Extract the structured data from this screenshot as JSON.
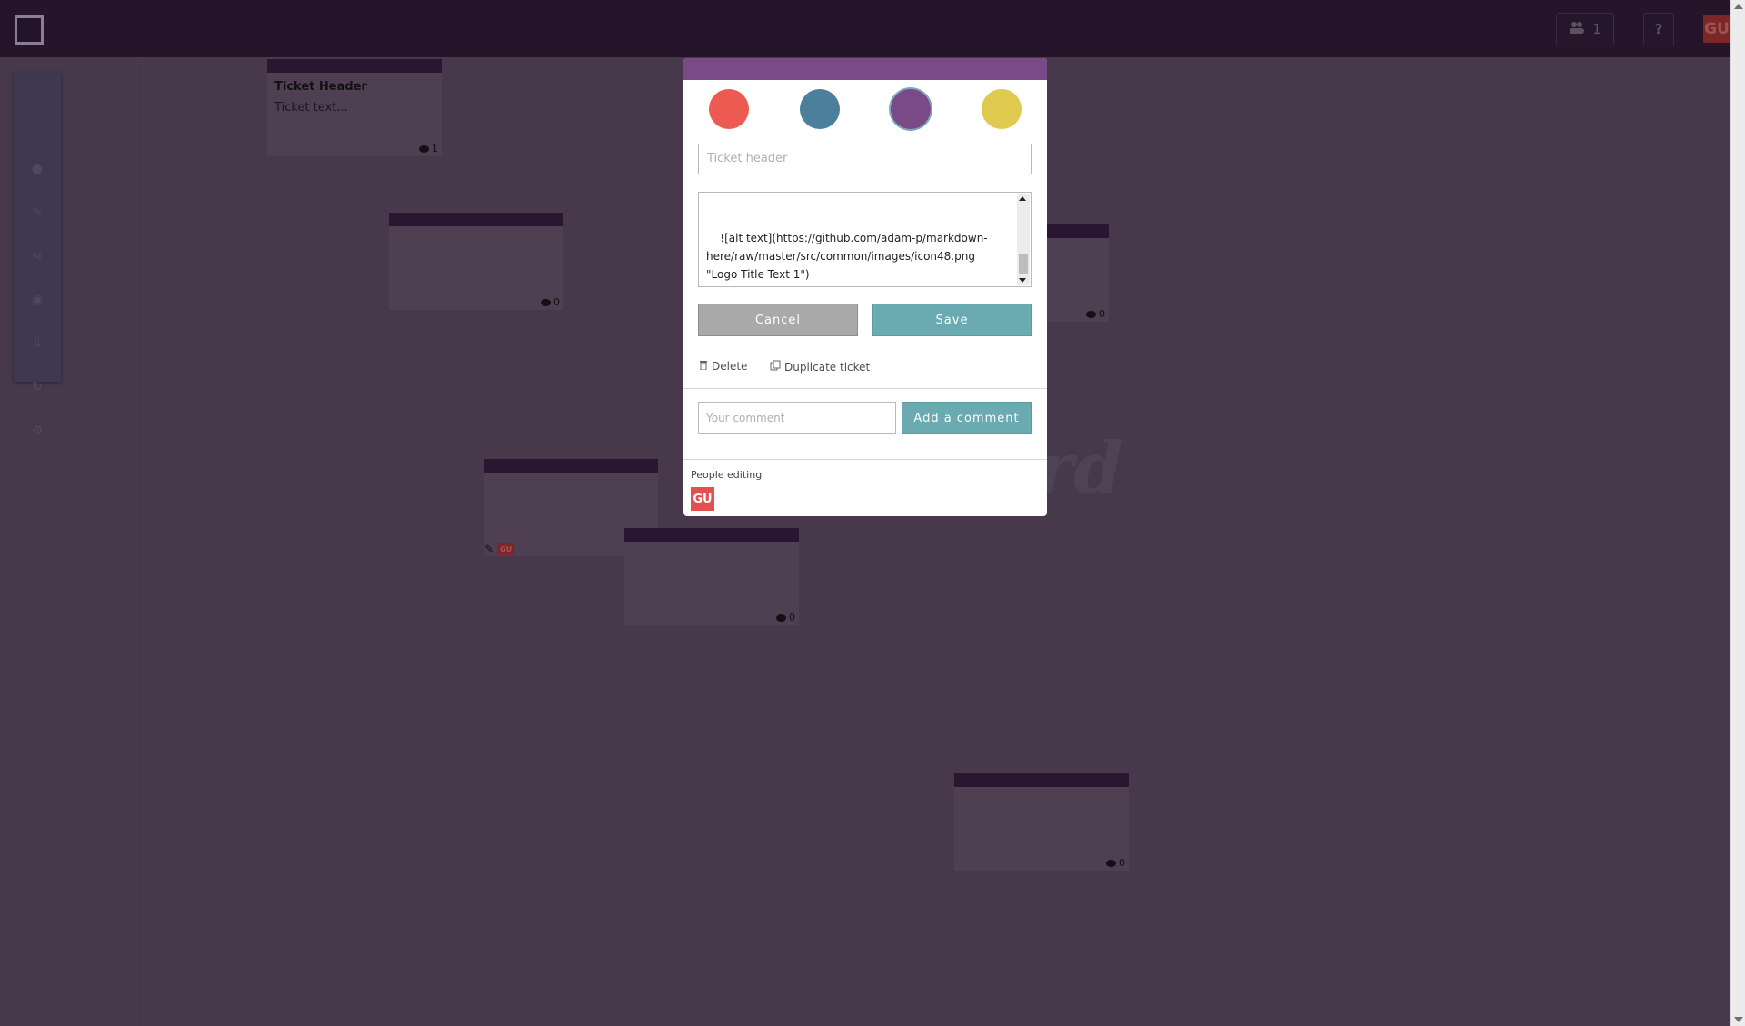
{
  "topbar": {
    "users_count": "1",
    "help_label": "?",
    "user_initials": "GU"
  },
  "tickets": [
    {
      "header": "Ticket Header",
      "text": "Ticket text...",
      "comments": "1"
    },
    {
      "header": "",
      "text": "",
      "comments": "0"
    },
    {
      "header": "",
      "text": "",
      "comments": "0"
    },
    {
      "header": "",
      "text": "",
      "comments": "0"
    },
    {
      "header": "",
      "text": "",
      "comments": "0"
    }
  ],
  "editing_ticket": {
    "editor_initials": "GU"
  },
  "modal": {
    "colors": [
      "#ec5a52",
      "#4c7f9c",
      "#7a4a86",
      "#e0c94f"
    ],
    "selected_color": "#7a4a86",
    "header_placeholder": "Ticket header",
    "body_text": "![alt text](https://github.com/adam-p/markdown-\nhere/raw/master/src/common/images/icon48.png\n\"Logo Title Text 1\")",
    "cancel_label": "Cancel",
    "save_label": "Save",
    "delete_label": "Delete",
    "duplicate_label": "Duplicate ticket",
    "comment_placeholder": "Your comment",
    "add_comment_label": "Add a comment",
    "people_editing_label": "People editing",
    "editor_initials": "GU"
  }
}
